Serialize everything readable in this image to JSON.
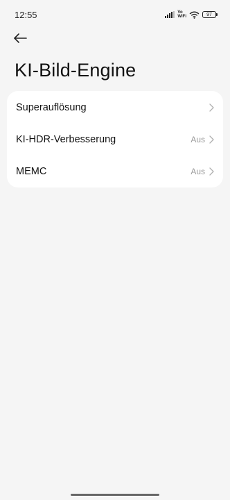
{
  "status_bar": {
    "time": "12:55",
    "vowifi_top": "Vo",
    "vowifi_bottom": "WiFi",
    "battery": "97"
  },
  "header": {
    "title": "KI-Bild-Engine"
  },
  "settings": {
    "items": [
      {
        "label": "Superauflösung",
        "value": ""
      },
      {
        "label": "KI-HDR-Verbesserung",
        "value": "Aus"
      },
      {
        "label": "MEMC",
        "value": "Aus"
      }
    ]
  },
  "colors": {
    "background": "#f5f5f5",
    "card": "#ffffff",
    "secondary_text": "#9a9a9a"
  }
}
